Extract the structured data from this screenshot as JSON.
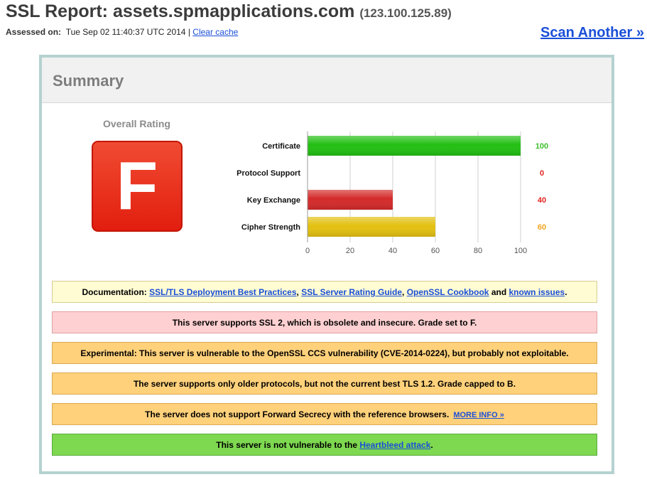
{
  "header": {
    "title_prefix": "SSL Report: ",
    "host": "assets.spmapplications.com",
    "ip": "(123.100.125.89)",
    "assessed_label": "Assessed on:",
    "assessed_date": "Tue Sep 02 11:40:37 UTC 2014",
    "separator": "|",
    "clear_cache": "Clear cache",
    "scan_another": "Scan Another »"
  },
  "summary": {
    "heading": "Summary",
    "overall_label": "Overall Rating",
    "grade": "F",
    "grade_color": "#e8321f"
  },
  "chart_data": {
    "type": "bar",
    "orientation": "horizontal",
    "categories": [
      "Certificate",
      "Protocol Support",
      "Key Exchange",
      "Cipher Strength"
    ],
    "values": [
      100,
      0,
      40,
      60
    ],
    "value_colors": [
      "#3bbf2b",
      "#e0221f",
      "#e0221f",
      "#f0a41e"
    ],
    "bar_colors": [
      "#22bf12",
      "#d42a2a",
      "#d42a2a",
      "#e3c010"
    ],
    "xlim": [
      0,
      100
    ],
    "xticks": [
      0,
      20,
      40,
      60,
      80,
      100
    ],
    "grid": true
  },
  "messages": {
    "doc_prefix": "Documentation: ",
    "doc_link1": "SSL/TLS Deployment Best Practices",
    "doc_sep1": ", ",
    "doc_link2": "SSL Server Rating Guide",
    "doc_sep2": ", ",
    "doc_link3": "OpenSSL Cookbook",
    "doc_and": " and ",
    "doc_link4": "known issues",
    "doc_end": ".",
    "ssl2": "This server supports SSL 2, which is obsolete and insecure. Grade set to F.",
    "ccs": "Experimental: This server is vulnerable to the OpenSSL CCS vulnerability (CVE-2014-0224), but probably not exploitable.",
    "protocols": "The server supports only older protocols, but not the current best TLS 1.2. Grade capped to B.",
    "fs": "The server does not support Forward Secrecy with the reference browsers.",
    "fs_more": "MORE INFO »",
    "hb_prefix": "This server is not vulnerable to the ",
    "hb_link": "Heartbleed attack",
    "hb_end": "."
  }
}
